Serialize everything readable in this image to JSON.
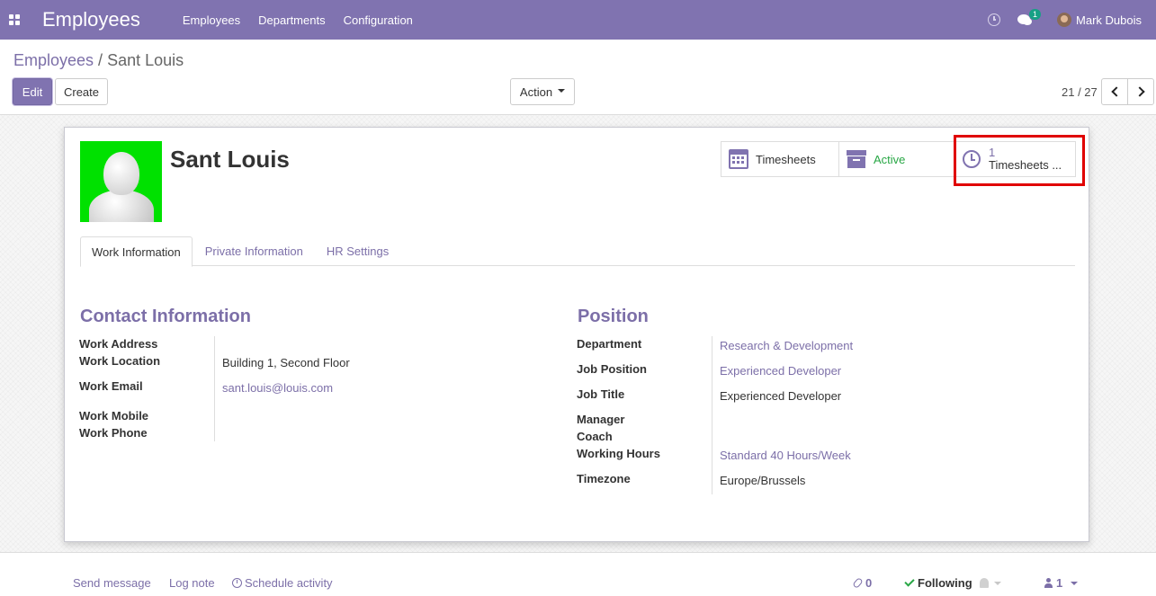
{
  "navbar": {
    "app_title": "Employees",
    "menu": [
      "Employees",
      "Departments",
      "Configuration"
    ],
    "chat_badge": "1",
    "user_name": "Mark Dubois"
  },
  "breadcrumb": {
    "parent": "Employees",
    "separator": "/",
    "current": "Sant Louis"
  },
  "toolbar": {
    "edit_label": "Edit",
    "create_label": "Create",
    "action_label": "Action"
  },
  "pager": {
    "value": "21 / 27"
  },
  "employee": {
    "name": "Sant Louis"
  },
  "smart_buttons": {
    "timesheets_label": "Timesheets",
    "active_label": "Active",
    "hours_value": "1",
    "hours_label": "Timesheets ..."
  },
  "tabs": [
    "Work Information",
    "Private Information",
    "HR Settings"
  ],
  "contact": {
    "title": "Contact Information",
    "work_address_label": "Work Address",
    "work_location_label": "Work Location",
    "work_location_value": "Building 1, Second Floor",
    "work_email_label": "Work Email",
    "work_email_value": "sant.louis@louis.com",
    "work_mobile_label": "Work Mobile",
    "work_phone_label": "Work Phone"
  },
  "position": {
    "title": "Position",
    "department_label": "Department",
    "department_value": "Research & Development",
    "job_position_label": "Job Position",
    "job_position_value": "Experienced Developer",
    "job_title_label": "Job Title",
    "job_title_value": "Experienced Developer",
    "manager_label": "Manager",
    "coach_label": "Coach",
    "working_hours_label": "Working Hours",
    "working_hours_value": "Standard 40 Hours/Week",
    "timezone_label": "Timezone",
    "timezone_value": "Europe/Brussels"
  },
  "chatter": {
    "send_message": "Send message",
    "log_note": "Log note",
    "schedule_activity": "Schedule activity",
    "attachments_count": "0",
    "following_label": "Following",
    "followers_count": "1"
  },
  "colors": {
    "brand": "#8073b0",
    "link": "#7c6fa8",
    "active": "#28a745",
    "highlight": "#e00000"
  }
}
